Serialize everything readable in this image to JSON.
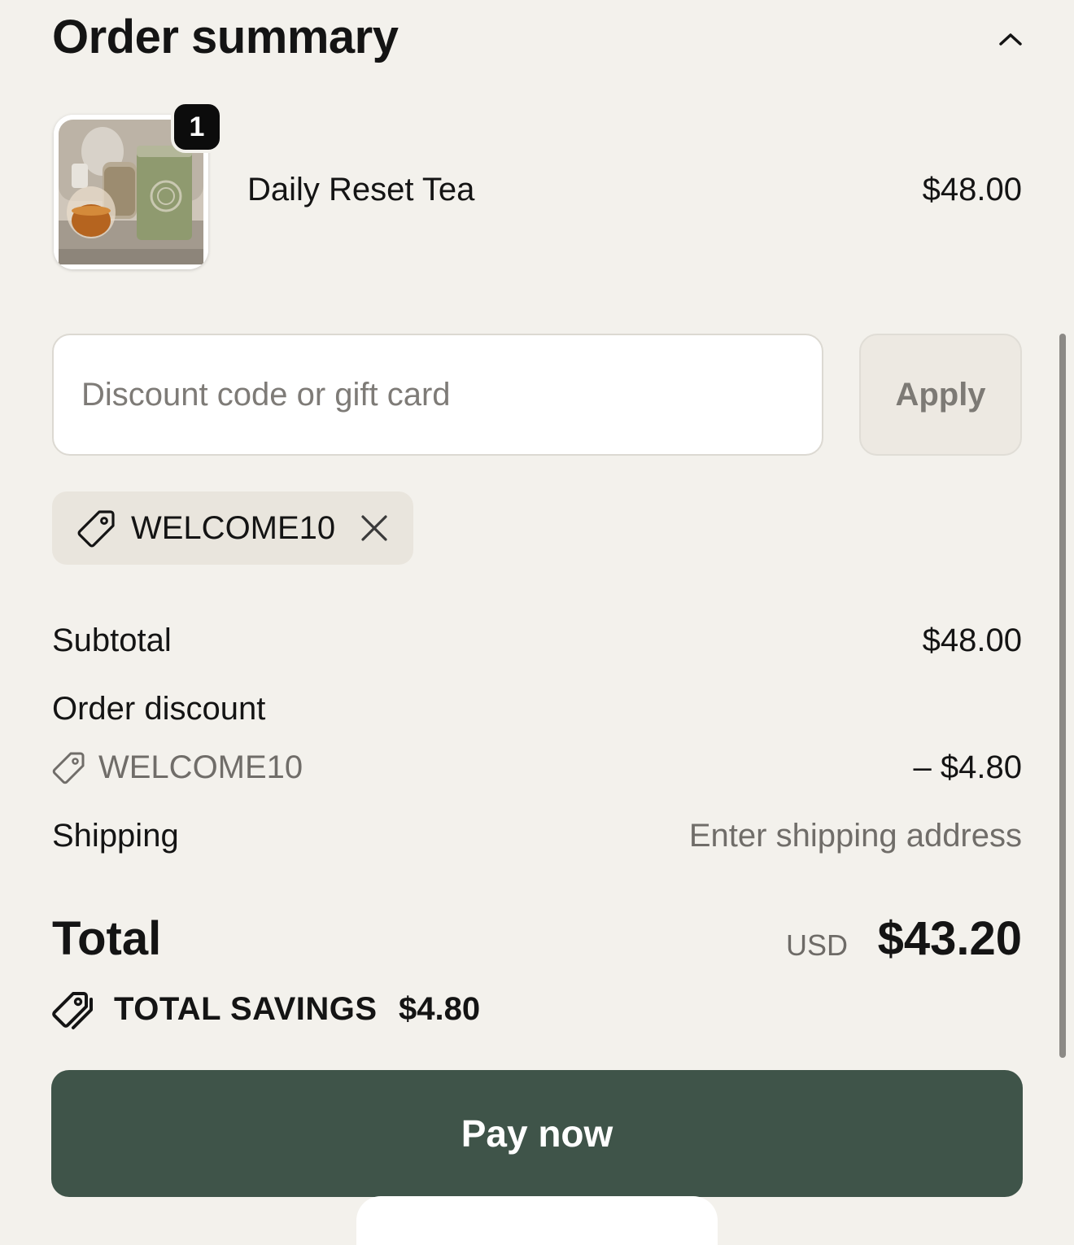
{
  "header": {
    "title": "Order summary",
    "collapse_icon": "chevron-up-icon"
  },
  "cart": {
    "items": [
      {
        "name": "Daily Reset Tea",
        "price": "$48.00",
        "quantity": "1",
        "image": "tea-product-photo"
      }
    ]
  },
  "discount": {
    "placeholder": "Discount code or gift card",
    "value": "",
    "apply_label": "Apply",
    "applied_code": "WELCOME10",
    "applied_icon": "tag-icon",
    "remove_icon": "close-icon"
  },
  "summary": {
    "subtotal_label": "Subtotal",
    "subtotal_value": "$48.00",
    "order_discount_label": "Order discount",
    "order_discount_code": "WELCOME10",
    "order_discount_value": "– $4.80",
    "shipping_label": "Shipping",
    "shipping_value": "Enter shipping address",
    "total_label": "Total",
    "currency": "USD",
    "total_value": "$43.20",
    "savings_label": "TOTAL SAVINGS",
    "savings_value": "$4.80"
  },
  "actions": {
    "pay_label": "Pay now"
  },
  "colors": {
    "background": "#f3f1ec",
    "pay_button": "#3f5449",
    "chip_bg": "#e9e5dd",
    "muted_text": "#706d69"
  }
}
